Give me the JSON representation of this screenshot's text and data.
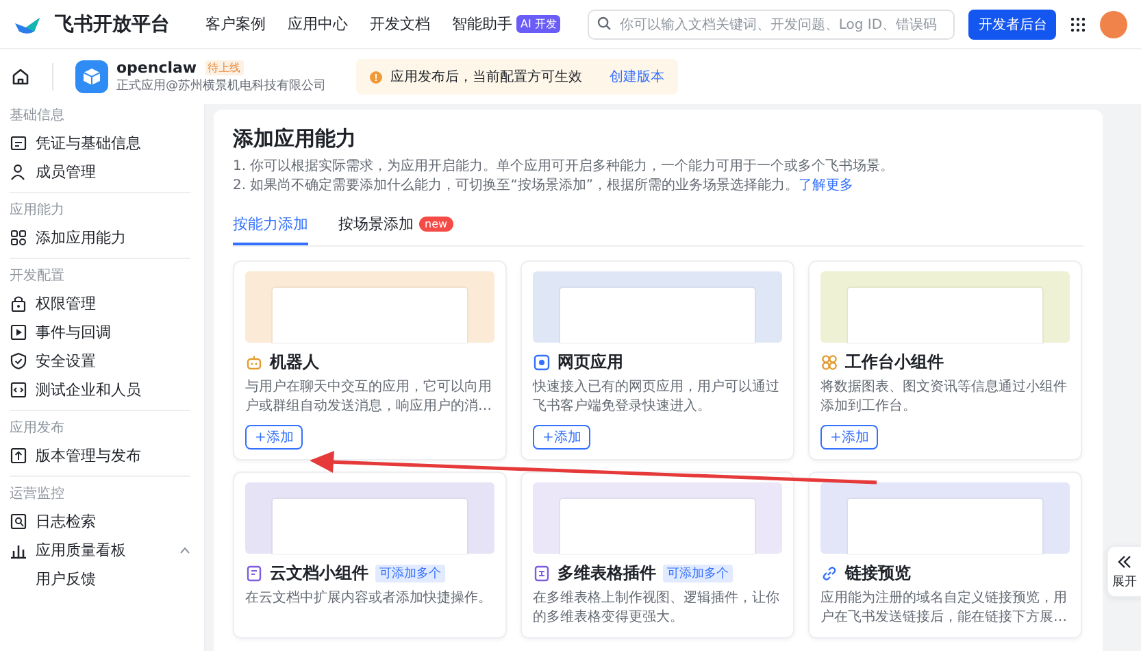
{
  "header": {
    "logo": "飞书开放平台",
    "nav": [
      {
        "label": "客户案例"
      },
      {
        "label": "应用中心"
      },
      {
        "label": "开发文档"
      },
      {
        "label": "智能助手",
        "badge": "AI 开发"
      }
    ],
    "search": {
      "placeholder": "你可以输入文档关键词、开发问题、Log ID、错误码"
    },
    "console_button": "开发者后台"
  },
  "app_bar": {
    "name": "openclaw",
    "status": "待上线",
    "subtitle": "正式应用@苏州横景机电科技有限公司",
    "notice": "应用发布后，当前配置方可生效",
    "notice_link": "创建版本"
  },
  "sidebar": {
    "groups": [
      {
        "title": "基础信息",
        "items": [
          {
            "label": "凭证与基础信息"
          },
          {
            "label": "成员管理"
          }
        ]
      },
      {
        "title": "应用能力",
        "items": [
          {
            "label": "添加应用能力"
          }
        ]
      },
      {
        "title": "开发配置",
        "items": [
          {
            "label": "权限管理"
          },
          {
            "label": "事件与回调"
          },
          {
            "label": "安全设置"
          },
          {
            "label": "测试企业和人员"
          }
        ]
      },
      {
        "title": "应用发布",
        "items": [
          {
            "label": "版本管理与发布"
          }
        ]
      },
      {
        "title": "运营监控",
        "items": [
          {
            "label": "日志检索"
          },
          {
            "label": "应用质量看板",
            "expanded": true,
            "children": [
              {
                "label": "用户反馈"
              }
            ]
          }
        ]
      }
    ]
  },
  "main": {
    "title": "添加应用能力",
    "notes": [
      {
        "text": "1. 你可以根据实际需求，为应用开启能力。单个应用可开启多种能力，一个能力可用于一个或多个飞书场景。"
      },
      {
        "text": "2. 如果尚不确定需要添加什么能力，可切换至“按场景添加”，根据所需的业务场景选择能力。",
        "link": "了解更多"
      }
    ],
    "tabs": [
      {
        "label": "按能力添加",
        "selected": true
      },
      {
        "label": "按场景添加",
        "selected": false,
        "badge": "new"
      }
    ],
    "cards": [
      {
        "title": "机器人",
        "description": "与用户在聊天中交互的应用，它可以向用户或群组自动发送消息，响应用户的消…",
        "button": "+添加"
      },
      {
        "title": "网页应用",
        "description": "快速接入已有的网页应用，用户可以通过飞书客户端免登录快速进入。",
        "button": "+添加"
      },
      {
        "title": "工作台小组件",
        "description": "将数据图表、图文资讯等信息通过小组件添加到工作台。",
        "button": "+添加"
      },
      {
        "title": "云文档小组件",
        "tag": "可添加多个",
        "description": "在云文档中扩展内容或者添加快捷操作。"
      },
      {
        "title": "多维表格插件",
        "tag": "可添加多个",
        "description": "在多维表格上制作视图、逻辑插件，让你的多维表格变得更强大。"
      },
      {
        "title": "链接预览",
        "description": "应用能为注册的域名自定义链接预览，用户在飞书发送链接后，能在链接下方展…"
      }
    ]
  },
  "expand_button": "展开"
}
